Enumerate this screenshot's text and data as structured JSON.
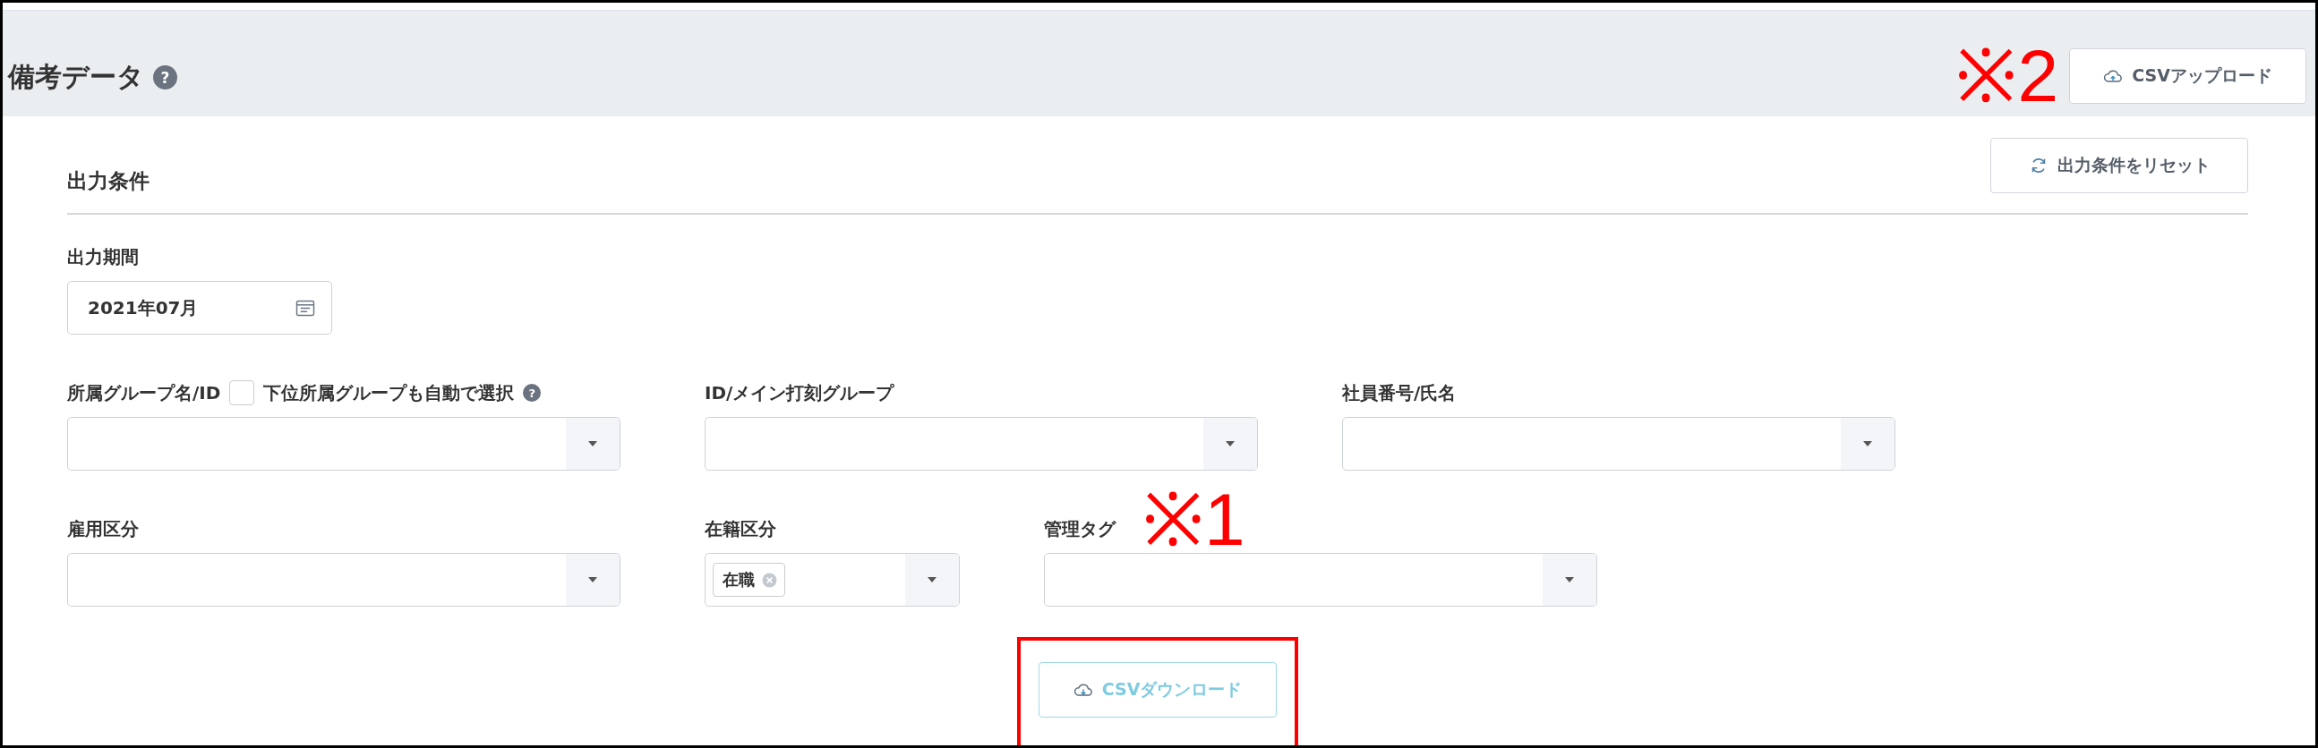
{
  "header": {
    "title": "備考データ",
    "help": "?",
    "annotation": "※2",
    "upload_button": "CSVアップロード"
  },
  "section": {
    "title": "出力条件",
    "reset_button": "出力条件をリセット"
  },
  "rows": [
    [
      {
        "kind": "date",
        "label": "出力期間",
        "value": "2021年07月"
      }
    ],
    [
      {
        "kind": "select",
        "label": "所属グループ名/ID",
        "checkbox": {
          "label": "下位所属グループも自動で選択",
          "checked": false,
          "help": "?"
        }
      },
      {
        "kind": "select",
        "label": "ID/メイン打刻グループ"
      },
      {
        "kind": "select",
        "label": "社員番号/氏名"
      }
    ],
    [
      {
        "kind": "select",
        "label": "雇用区分"
      },
      {
        "kind": "tag_select",
        "label": "在籍区分",
        "tags": [
          "在職"
        ]
      },
      {
        "kind": "select",
        "label": "管理タグ",
        "annotation": "※1"
      }
    ]
  ],
  "download_button": {
    "label": "CSVダウンロード",
    "disabled": true,
    "highlighted": true
  }
}
